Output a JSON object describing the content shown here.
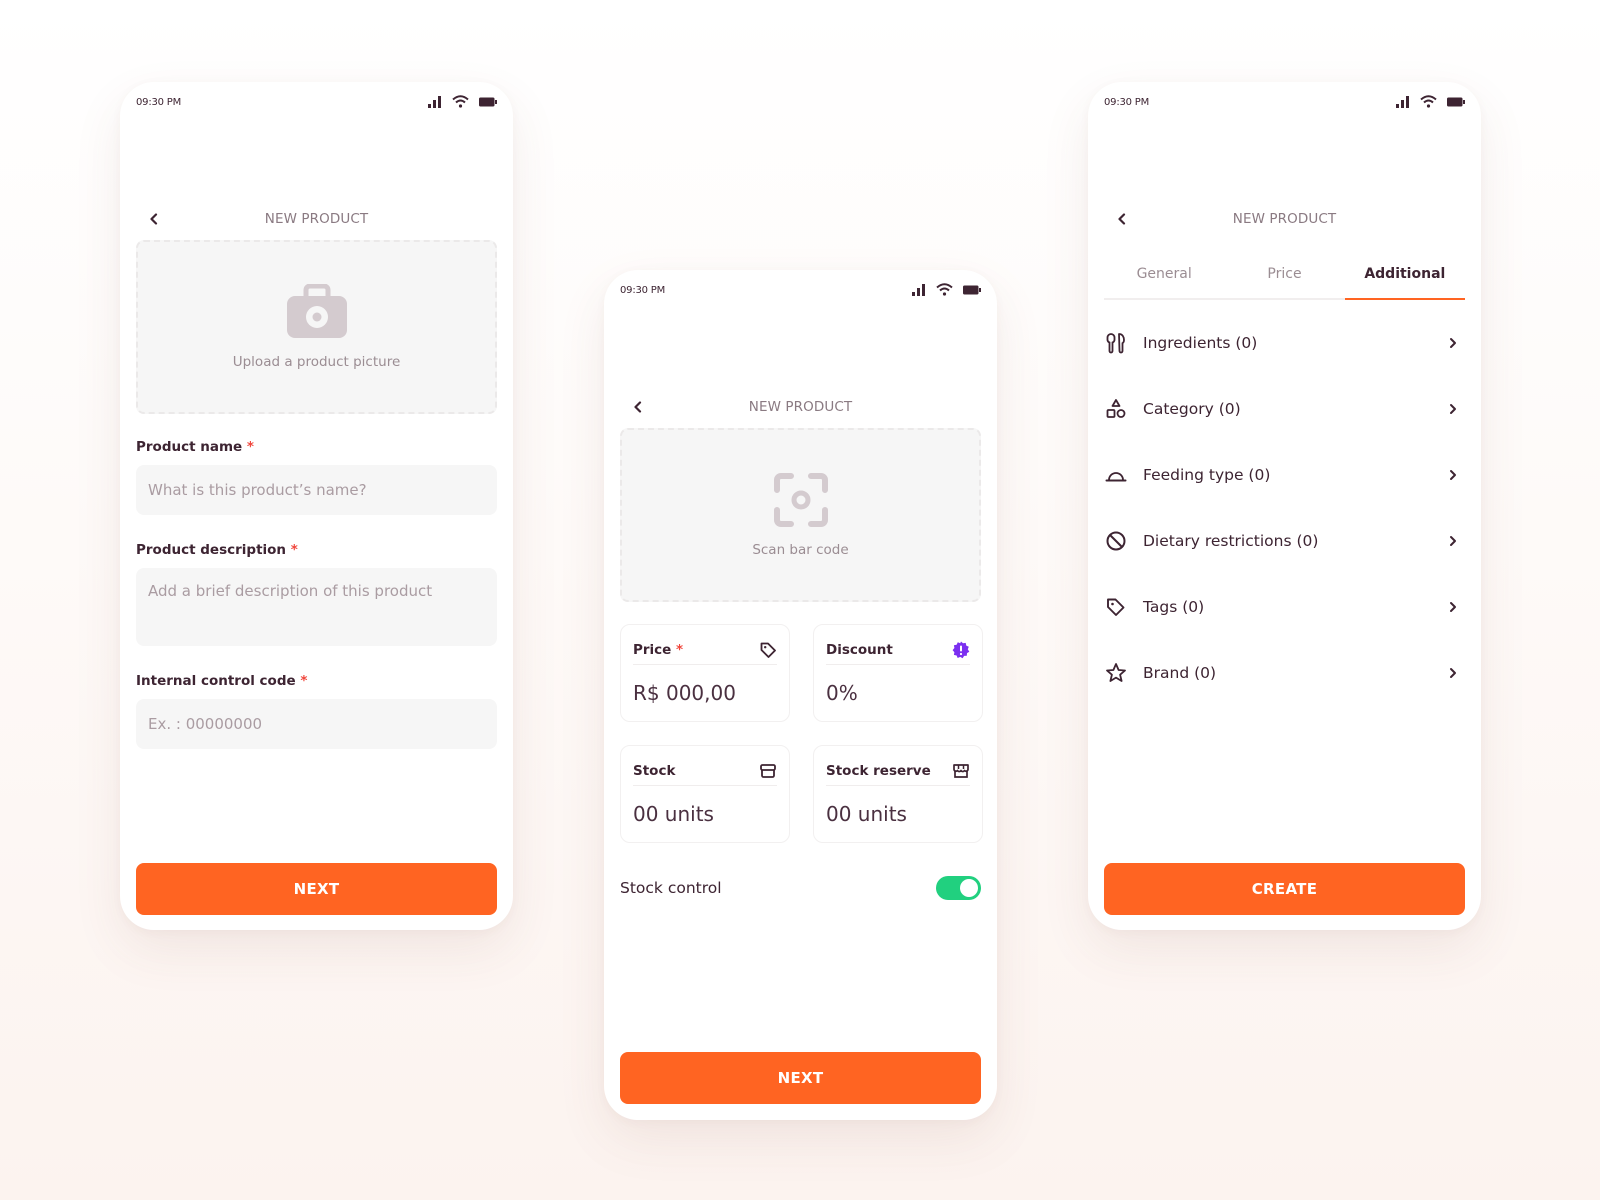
{
  "colors": {
    "accent": "#ff6422",
    "text_primary": "#3d2432",
    "text_muted": "#9b8d93",
    "required": "#f0463c",
    "toggle_on": "#21d07f",
    "discount_badge": "#7b2ff0",
    "placeholder_icon": "#d4cbcf"
  },
  "status_bar": {
    "time": "09:30 PM",
    "icons": [
      "signal-icon",
      "wifi-icon",
      "battery-icon"
    ]
  },
  "header": {
    "title": "NEW PRODUCT",
    "back_icon": "chevron-left-icon"
  },
  "tabs": [
    {
      "label": "General"
    },
    {
      "label": "Price"
    },
    {
      "label": "Additional"
    }
  ],
  "screen_general": {
    "active_tab": "General",
    "upload": {
      "icon": "camera-icon",
      "label": "Upload a product picture"
    },
    "fields": [
      {
        "label": "Product name",
        "required": "*",
        "placeholder": "What is this product’s name?",
        "value": ""
      },
      {
        "label": "Product description",
        "required": "*",
        "placeholder": "Add a brief description of this product",
        "value": ""
      },
      {
        "label": "Internal control code",
        "required": "*",
        "placeholder": "Ex. : 00000000",
        "value": ""
      }
    ],
    "button": "NEXT"
  },
  "screen_price": {
    "active_tab": "Price",
    "scan": {
      "icon": "scan-icon",
      "label": "Scan bar code"
    },
    "cards": [
      {
        "title": "Price",
        "required": "*",
        "icon": "tag-icon",
        "value": "R$ 000,00"
      },
      {
        "title": "Discount",
        "required": "",
        "icon": "alert-badge-icon",
        "value": "0%"
      },
      {
        "title": "Stock",
        "required": "",
        "icon": "box-icon",
        "value": "00 units"
      },
      {
        "title": "Stock reserve",
        "required": "",
        "icon": "store-icon",
        "value": "00 units"
      }
    ],
    "stock_control": {
      "label": "Stock control",
      "enabled": true
    },
    "button": "NEXT"
  },
  "screen_additional": {
    "active_tab": "Additional",
    "items": [
      {
        "label": "Ingredients (0)",
        "icon": "utensils-icon"
      },
      {
        "label": "Category (0)",
        "icon": "shapes-icon"
      },
      {
        "label": "Feeding type (0)",
        "icon": "cloche-icon"
      },
      {
        "label": "Dietary restrictions (0)",
        "icon": "prohibited-icon"
      },
      {
        "label": "Tags (0)",
        "icon": "tag-icon"
      },
      {
        "label": "Brand (0)",
        "icon": "star-icon"
      }
    ],
    "button": "CREATE"
  }
}
